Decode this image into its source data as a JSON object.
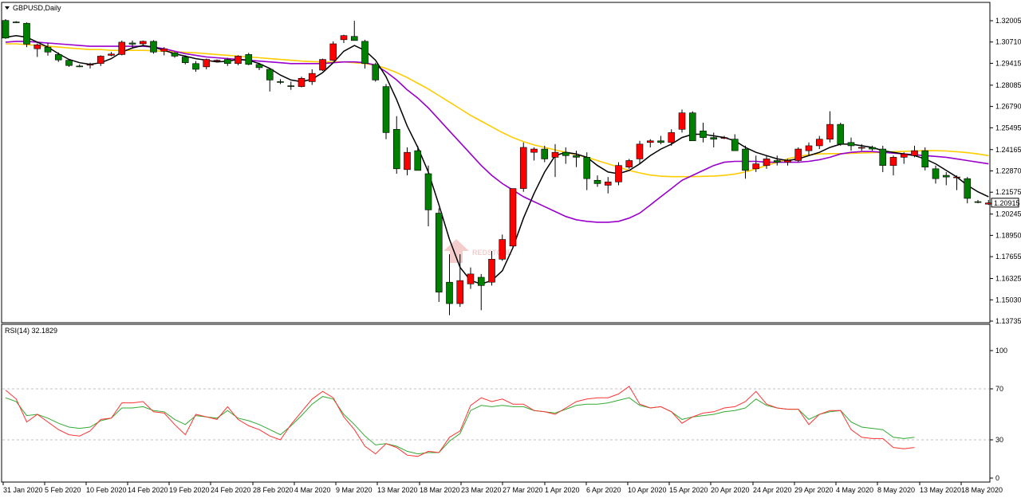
{
  "chart_data": {
    "type": "candlestick",
    "symbol_label": "GBPUSD,Daily",
    "watermark": "REDSTONE",
    "colors": {
      "bull": "#ff0000",
      "bear": "#008000",
      "ma_fast": "#000000",
      "ma_mid": "#9900cc",
      "ma_slow": "#ffcc00",
      "rsi_main": "#ff3333",
      "rsi_signal": "#33aa33",
      "last_price_bg": "#ffffff"
    },
    "price_axis": {
      "range": [
        1.1374,
        1.3255
      ],
      "ticks": [
        "1.32005",
        "1.30710",
        "1.29415",
        "1.28085",
        "1.26790",
        "1.25495",
        "1.24165",
        "1.22870",
        "1.21575",
        "1.20245",
        "1.18950",
        "1.17655",
        "1.16325",
        "1.15030",
        "1.13735"
      ],
      "last_price": "1.20915"
    },
    "rsi_axis": {
      "range": [
        0,
        100
      ],
      "ticks": [
        "100",
        "70",
        "30",
        "0"
      ],
      "levels": [
        70,
        30
      ]
    },
    "rsi_label": "RSI(14) 32.1829",
    "x_labels": [
      "31 Jan 2020",
      "5 Feb 2020",
      "10 Feb 2020",
      "14 Feb 2020",
      "19 Feb 2020",
      "24 Feb 2020",
      "28 Feb 2020",
      "4 Mar 2020",
      "9 Mar 2020",
      "13 Mar 2020",
      "18 Mar 2020",
      "23 Mar 2020",
      "27 Mar 2020",
      "1 Apr 2020",
      "6 Apr 2020",
      "10 Apr 2020",
      "15 Apr 2020",
      "20 Apr 2020",
      "24 Apr 2020",
      "29 Apr 2020",
      "4 May 2020",
      "8 May 2020",
      "13 May 2020",
      "18 May 2020"
    ],
    "candles": [
      [
        1.3202,
        1.321,
        1.309,
        1.3095
      ],
      [
        1.3193,
        1.3198,
        1.3188,
        1.319
      ],
      [
        1.3185,
        1.319,
        1.304,
        1.3058
      ],
      [
        1.303,
        1.3062,
        1.298,
        1.3054
      ],
      [
        1.304,
        1.3065,
        1.2988,
        1.301
      ],
      [
        1.2995,
        1.3008,
        1.295,
        1.2962
      ],
      [
        1.296,
        1.2968,
        1.292,
        1.2928
      ],
      [
        1.2925,
        1.2935,
        1.2918,
        1.292
      ],
      [
        1.293,
        1.2945,
        1.291,
        1.2935
      ],
      [
        1.294,
        1.299,
        1.2925,
        1.2985
      ],
      [
        1.299,
        1.301,
        1.2985,
        1.2998
      ],
      [
        1.2995,
        1.308,
        1.299,
        1.307
      ],
      [
        1.3065,
        1.308,
        1.303,
        1.3058
      ],
      [
        1.306,
        1.308,
        1.3045,
        1.3075
      ],
      [
        1.3075,
        1.3082,
        1.3,
        1.301
      ],
      [
        1.3015,
        1.304,
        1.299,
        1.303
      ],
      [
        1.3005,
        1.301,
        1.2975,
        1.2985
      ],
      [
        1.298,
        1.299,
        1.2935,
        1.2945
      ],
      [
        1.294,
        1.2955,
        1.289,
        1.2905
      ],
      [
        1.292,
        1.297,
        1.2905,
        1.2965
      ],
      [
        1.296,
        1.2965,
        1.2955,
        1.296
      ],
      [
        1.2965,
        1.2975,
        1.2925,
        1.294
      ],
      [
        1.294,
        1.299,
        1.293,
        1.2985
      ],
      [
        1.2995,
        1.3005,
        1.293,
        1.2935
      ],
      [
        1.2935,
        1.2945,
        1.29,
        1.2915
      ],
      [
        1.2905,
        1.291,
        1.277,
        1.284
      ],
      [
        1.283,
        1.2845,
        1.2815,
        1.2828
      ],
      [
        1.2805,
        1.283,
        1.278,
        1.28
      ],
      [
        1.28,
        1.286,
        1.2795,
        1.285
      ],
      [
        1.283,
        1.2905,
        1.281,
        1.288
      ],
      [
        1.29,
        1.297,
        1.2895,
        1.2965
      ],
      [
        1.296,
        1.3075,
        1.2955,
        1.306
      ],
      [
        1.3085,
        1.3115,
        1.3065,
        1.311
      ],
      [
        1.3105,
        1.32,
        1.309,
        1.308
      ],
      [
        1.3075,
        1.3085,
        1.291,
        1.294
      ],
      [
        1.2935,
        1.2945,
        1.283,
        1.284
      ],
      [
        1.28,
        1.2815,
        1.248,
        1.252
      ],
      [
        1.254,
        1.262,
        1.227,
        1.23
      ],
      [
        1.2295,
        1.243,
        1.226,
        1.24
      ],
      [
        1.241,
        1.244,
        1.229,
        1.229
      ],
      [
        1.227,
        1.232,
        1.195,
        1.205
      ],
      [
        1.203,
        1.206,
        1.149,
        1.155
      ],
      [
        1.161,
        1.178,
        1.141,
        1.148
      ],
      [
        1.148,
        1.178,
        1.146,
        1.162
      ],
      [
        1.16,
        1.17,
        1.157,
        1.166
      ],
      [
        1.164,
        1.166,
        1.144,
        1.159
      ],
      [
        1.161,
        1.18,
        1.159,
        1.175
      ],
      [
        1.175,
        1.19,
        1.174,
        1.187
      ],
      [
        1.183,
        1.209,
        1.182,
        1.218
      ],
      [
        1.218,
        1.246,
        1.216,
        1.243
      ],
      [
        1.24,
        1.243,
        1.235,
        1.242
      ],
      [
        1.242,
        1.244,
        1.234,
        1.236
      ],
      [
        1.237,
        1.245,
        1.225,
        1.24
      ],
      [
        1.24,
        1.243,
        1.233,
        1.238
      ],
      [
        1.238,
        1.241,
        1.231,
        1.237
      ],
      [
        1.237,
        1.24,
        1.217,
        1.224
      ],
      [
        1.223,
        1.226,
        1.219,
        1.221
      ],
      [
        1.22,
        1.225,
        1.215,
        1.222
      ],
      [
        1.222,
        1.234,
        1.22,
        1.232
      ],
      [
        1.231,
        1.236,
        1.23,
        1.235
      ],
      [
        1.236,
        1.247,
        1.233,
        1.245
      ],
      [
        1.246,
        1.248,
        1.243,
        1.247
      ],
      [
        1.247,
        1.25,
        1.245,
        1.246
      ],
      [
        1.246,
        1.254,
        1.244,
        1.252
      ],
      [
        1.254,
        1.266,
        1.252,
        1.264
      ],
      [
        1.264,
        1.265,
        1.247,
        1.247
      ],
      [
        1.253,
        1.258,
        1.246,
        1.249
      ],
      [
        1.249,
        1.252,
        1.243,
        1.248
      ],
      [
        1.249,
        1.25,
        1.248,
        1.249
      ],
      [
        1.248,
        1.251,
        1.241,
        1.241
      ],
      [
        1.242,
        1.244,
        1.224,
        1.229
      ],
      [
        1.23,
        1.238,
        1.228,
        1.233
      ],
      [
        1.232,
        1.238,
        1.23,
        1.236
      ],
      [
        1.235,
        1.238,
        1.232,
        1.234
      ],
      [
        1.234,
        1.236,
        1.232,
        1.235
      ],
      [
        1.235,
        1.243,
        1.234,
        1.242
      ],
      [
        1.241,
        1.246,
        1.238,
        1.244
      ],
      [
        1.244,
        1.25,
        1.242,
        1.248
      ],
      [
        1.248,
        1.265,
        1.246,
        1.257
      ],
      [
        1.257,
        1.258,
        1.244,
        1.245
      ],
      [
        1.246,
        1.249,
        1.241,
        1.244
      ],
      [
        1.243,
        1.245,
        1.241,
        1.243
      ],
      [
        1.243,
        1.244,
        1.241,
        1.242
      ],
      [
        1.242,
        1.244,
        1.228,
        1.232
      ],
      [
        1.232,
        1.238,
        1.226,
        1.237
      ],
      [
        1.237,
        1.24,
        1.233,
        1.239
      ],
      [
        1.238,
        1.244,
        1.237,
        1.241
      ],
      [
        1.241,
        1.243,
        1.229,
        1.231
      ],
      [
        1.23,
        1.232,
        1.221,
        1.224
      ],
      [
        1.226,
        1.228,
        1.22,
        1.225
      ],
      [
        1.225,
        1.226,
        1.217,
        1.225
      ],
      [
        1.224,
        1.225,
        1.209,
        1.212
      ],
      [
        1.21,
        1.211,
        1.209,
        1.2095
      ],
      [
        1.2085,
        1.211,
        1.208,
        1.2092
      ]
    ],
    "ma_fast": [
      1.31,
      1.311,
      1.31,
      1.307,
      1.304,
      1.3,
      1.2965,
      1.2945,
      1.2935,
      1.2945,
      1.297,
      1.301,
      1.3035,
      1.305,
      1.304,
      1.302,
      1.3,
      1.2985,
      1.297,
      1.296,
      1.295,
      1.2955,
      1.2965,
      1.296,
      1.294,
      1.291,
      1.287,
      1.284,
      1.283,
      1.2845,
      1.2885,
      1.2945,
      1.3015,
      1.305,
      1.302,
      1.296,
      1.286,
      1.272,
      1.256,
      1.243,
      1.228,
      1.208,
      1.187,
      1.17,
      1.162,
      1.16,
      1.162,
      1.168,
      1.182,
      1.2,
      1.215,
      1.228,
      1.238,
      1.24,
      1.239,
      1.237,
      1.232,
      1.228,
      1.227,
      1.229,
      1.233,
      1.238,
      1.242,
      1.245,
      1.249,
      1.251,
      1.251,
      1.25,
      1.249,
      1.247,
      1.243,
      1.24,
      1.238,
      1.236,
      1.235,
      1.236,
      1.238,
      1.24,
      1.243,
      1.245,
      1.245,
      1.244,
      1.243,
      1.241,
      1.24,
      1.239,
      1.238,
      1.236,
      1.233,
      1.229,
      1.225,
      1.22,
      1.216,
      1.213
    ],
    "ma_mid": [
      1.307,
      1.3075,
      1.3075,
      1.307,
      1.3065,
      1.306,
      1.3055,
      1.305,
      1.3045,
      1.3045,
      1.3045,
      1.3045,
      1.3045,
      1.3045,
      1.304,
      1.303,
      1.3015,
      1.3,
      1.299,
      1.298,
      1.2975,
      1.297,
      1.2965,
      1.296,
      1.2955,
      1.295,
      1.2945,
      1.294,
      1.294,
      1.294,
      1.294,
      1.2945,
      1.295,
      1.295,
      1.2945,
      1.293,
      1.289,
      1.284,
      1.278,
      1.273,
      1.267,
      1.26,
      1.253,
      1.246,
      1.239,
      1.232,
      1.226,
      1.221,
      1.217,
      1.213,
      1.21,
      1.207,
      1.204,
      1.201,
      1.199,
      1.198,
      1.1975,
      1.1975,
      1.198,
      1.2,
      1.203,
      1.208,
      1.213,
      1.218,
      1.223,
      1.226,
      1.229,
      1.232,
      1.234,
      1.2345,
      1.2345,
      1.2345,
      1.234,
      1.234,
      1.234,
      1.234,
      1.2345,
      1.2355,
      1.237,
      1.239,
      1.24,
      1.2405,
      1.2405,
      1.24,
      1.2395,
      1.239,
      1.2385,
      1.238,
      1.2375,
      1.237,
      1.236,
      1.235,
      1.234,
      1.233
    ],
    "ma_slow": [
      1.306,
      1.306,
      1.3055,
      1.305,
      1.3045,
      1.304,
      1.3035,
      1.303,
      1.3025,
      1.3025,
      1.302,
      1.302,
      1.302,
      1.302,
      1.3018,
      1.3015,
      1.3012,
      1.3008,
      1.3005,
      1.3,
      1.2995,
      1.299,
      1.2985,
      1.298,
      1.2975,
      1.297,
      1.2965,
      1.296,
      1.2955,
      1.2952,
      1.295,
      1.295,
      1.295,
      1.2945,
      1.294,
      1.293,
      1.291,
      1.2885,
      1.2855,
      1.282,
      1.2785,
      1.2745,
      1.2705,
      1.2665,
      1.2625,
      1.259,
      1.2555,
      1.252,
      1.249,
      1.2465,
      1.2445,
      1.243,
      1.2415,
      1.24,
      1.2385,
      1.237,
      1.235,
      1.233,
      1.231,
      1.229,
      1.2275,
      1.2262,
      1.2255,
      1.2252,
      1.2252,
      1.2252,
      1.2254,
      1.2256,
      1.226,
      1.2268,
      1.228,
      1.23,
      1.232,
      1.234,
      1.236,
      1.2375,
      1.2385,
      1.239,
      1.2392,
      1.2392,
      1.2394,
      1.2396,
      1.2398,
      1.24,
      1.2403,
      1.2406,
      1.2408,
      1.241,
      1.241,
      1.2408,
      1.2404,
      1.2398,
      1.239,
      1.238
    ],
    "rsi": [
      69,
      62,
      44,
      50,
      44,
      38,
      34,
      33,
      37,
      46,
      47,
      59,
      59,
      60,
      52,
      51,
      42,
      34,
      50,
      48,
      46,
      56,
      46,
      41,
      38,
      33,
      30,
      42,
      52,
      62,
      68,
      63,
      48,
      38,
      25,
      19,
      27,
      24,
      18,
      17,
      21,
      20,
      32,
      37,
      57,
      63,
      60,
      62,
      58,
      58,
      53,
      52,
      50,
      55,
      60,
      62,
      63,
      63,
      66,
      72,
      58,
      55,
      56,
      52,
      43,
      48,
      51,
      52,
      55,
      56,
      60,
      68,
      58,
      55,
      54,
      54,
      42,
      50,
      53,
      53,
      38,
      32,
      31,
      31,
      24,
      23,
      24
    ],
    "rsi_signal": [
      63,
      60,
      49,
      50,
      47,
      43,
      40,
      39,
      40,
      45,
      47,
      55,
      55,
      56,
      53,
      52,
      46,
      42,
      49,
      48,
      47,
      53,
      47,
      45,
      42,
      38,
      34,
      41,
      49,
      58,
      64,
      62,
      50,
      42,
      33,
      26,
      27,
      25,
      21,
      19,
      20,
      20,
      29,
      35,
      53,
      57,
      56,
      57,
      56,
      56,
      53,
      52,
      51,
      54,
      57,
      58,
      58,
      59,
      61,
      63,
      57,
      55,
      56,
      52,
      46,
      48,
      49,
      50,
      52,
      53,
      55,
      62,
      57,
      55,
      54,
      54,
      46,
      50,
      52,
      53,
      44,
      40,
      39,
      38,
      32,
      31,
      32
    ]
  }
}
